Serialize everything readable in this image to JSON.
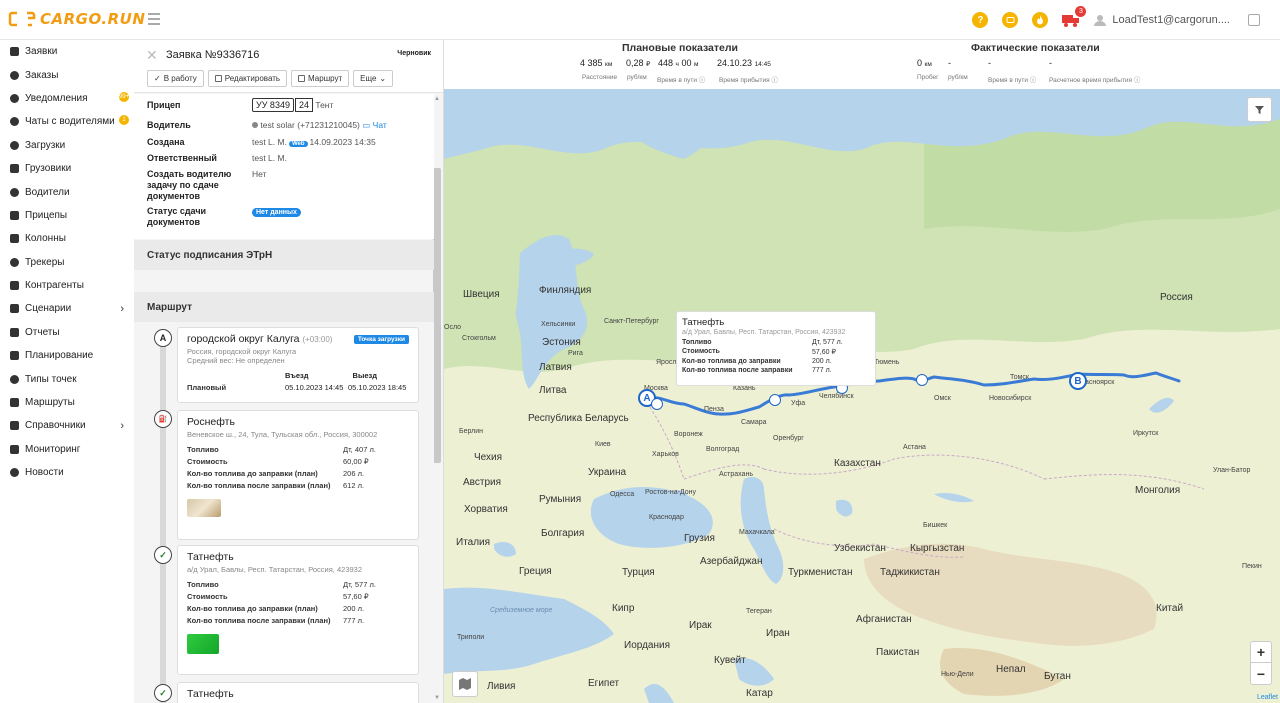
{
  "header": {
    "logo": "CARGO.RUN",
    "help_icon": "?",
    "truck_badge": "3",
    "user": "LoadTest1@cargorun...."
  },
  "sidebar": {
    "items": [
      {
        "label": "Заявки",
        "icon": "clipboard-icon"
      },
      {
        "label": "Заказы",
        "icon": "ruble-icon"
      },
      {
        "label": "Уведомления",
        "icon": "bell-icon",
        "badge": "99+"
      },
      {
        "label": "Чаты с водителями",
        "icon": "chat-icon",
        "badge": "1"
      },
      {
        "label": "Загрузки",
        "icon": "download-icon"
      },
      {
        "label": "Грузовики",
        "icon": "truck-icon"
      },
      {
        "label": "Водители",
        "icon": "steering-wheel-icon"
      },
      {
        "label": "Прицепы",
        "icon": "trailer-icon"
      },
      {
        "label": "Колонны",
        "icon": "convoy-icon"
      },
      {
        "label": "Трекеры",
        "icon": "location-pin-icon"
      },
      {
        "label": "Контрагенты",
        "icon": "handshake-icon"
      },
      {
        "label": "Сценарии",
        "icon": "list-icon",
        "arrow": "›"
      },
      {
        "label": "Отчеты",
        "icon": "report-icon"
      },
      {
        "label": "Планирование",
        "icon": "planning-icon"
      },
      {
        "label": "Типы точек",
        "icon": "pin-icon"
      },
      {
        "label": "Маршруты",
        "icon": "route-icon"
      },
      {
        "label": "Справочники",
        "icon": "book-icon",
        "arrow": "›"
      },
      {
        "label": "Мониторинг",
        "icon": "monitor-icon"
      },
      {
        "label": "Новости",
        "icon": "info-icon"
      }
    ]
  },
  "panel": {
    "title": "Заявка №9336716",
    "status": "Черновик",
    "buttons": {
      "work": "В работу",
      "edit": "Редактировать",
      "route": "Маршрут",
      "more": "Еще"
    },
    "info": {
      "trailer_label": "Прицеп",
      "trailer_plate": "УУ 8349",
      "trailer_region": "24",
      "trailer_name": "Тент",
      "driver_label": "Водитель",
      "driver_value": "test solar",
      "driver_phone": "(+71231210045)",
      "chat": "Чат",
      "created_label": "Создана",
      "created_by": "test L. M.",
      "created_web": "Web",
      "created_date": "14.09.2023 14:35",
      "responsible_label": "Ответственный",
      "responsible_value": "test L. M.",
      "task_label": "Создать водителю задачу по сдаче документов",
      "task_value": "Нет",
      "docs_label": "Статус сдачи документов",
      "docs_value": "Нет данных"
    },
    "etrn_section": "Статус подписания ЭТрН",
    "route_section": "Маршрут",
    "route_pin_a": "A",
    "cards": [
      {
        "title": "городской округ Калуга",
        "tz": "(+03:00)",
        "tag": "Точка загрузки",
        "address": "Россия, городской округ Калуга",
        "weight": "Средний вес: Не определен",
        "entry_label": "Въезд",
        "exit_label": "Выезд",
        "planned_label": "Плановый",
        "entry": "05.10.2023 14:45",
        "exit": "05.10.2023 18:45"
      },
      {
        "title": "Роснефть",
        "address": "Веневское ш., 24, Тула, Тульская обл., Россия, 300002",
        "fuel_label": "Топливо",
        "fuel": "Дт, 407 л.",
        "cost_label": "Стоимость",
        "cost": "60,00 ₽",
        "before_label": "Кол-во топлива до заправки (план)",
        "before": "206 л.",
        "after_label": "Кол-во топлива после заправки (план)",
        "after": "612 л."
      },
      {
        "title": "Татнефть",
        "address": "а/д Урал, Бавлы, Респ. Татарстан, Россия, 423932",
        "fuel_label": "Топливо",
        "fuel": "Дт, 577 л.",
        "cost_label": "Стоимость",
        "cost": "57,60 ₽",
        "before_label": "Кол-во топлива до заправки (план)",
        "before": "200 л.",
        "after_label": "Кол-во топлива после заправки (план)",
        "after": "777 л."
      },
      {
        "title": "Татнефть"
      }
    ]
  },
  "stats": {
    "planned_title": "Плановые показатели",
    "actual_title": "Фактические показатели",
    "planned": {
      "distance": "4 385",
      "distance_unit": "км",
      "rate": "0,28",
      "rate_unit": "₽",
      "time_h": "448",
      "time_m": "00",
      "arrival": "24.10.23",
      "arrival_time": "14:45",
      "l_distance": "Расстояние",
      "l_rate": "руб/км",
      "l_time": "Время в пути",
      "l_arrival": "Время прибытия"
    },
    "actual": {
      "run": "0",
      "run_unit": "км",
      "rate": "-",
      "time": "-",
      "arrival": "-",
      "l_run": "Пробег",
      "l_rate": "руб/км",
      "l_time": "Время в пути",
      "l_arrival": "Расчетное время прибытия"
    }
  },
  "map": {
    "popup": {
      "title": "Татнефть",
      "address": "а/д Урал, Бавлы, Респ. Татарстан, Россия, 423932",
      "fuel_label": "Топливо",
      "fuel": "Дт, 577 л.",
      "cost_label": "Стоимость",
      "cost": "57,60 ₽",
      "before_label": "Кол-во топлива до заправки",
      "before": "200 л.",
      "after_label": "Кол-во топлива после заправки",
      "after": "777 л."
    },
    "pin_a": "A",
    "pin_b": "B",
    "zoom_in": "+",
    "zoom_out": "−",
    "attribution": "Leaflet",
    "labels": {
      "russia": "Россия",
      "sweden": "Швеция",
      "finland": "Финляндия",
      "estonia": "Эстония",
      "latvia": "Латвия",
      "lithuania": "Литва",
      "belarus": "Республика Беларусь",
      "ukraine": "Украина",
      "czech": "Чехия",
      "austria": "Австрия",
      "croatia": "Хорватия",
      "italy": "Италия",
      "romania": "Румыния",
      "bulgaria": "Болгария",
      "greece": "Греция",
      "turkey": "Турция",
      "georgia": "Грузия",
      "azerbaijan": "Азербайджан",
      "kazakhstan": "Казахстан",
      "mongolia": "Монголия",
      "uzbekistan": "Узбекистан",
      "kyrgyzstan": "Кыргызстан",
      "turkmenistan": "Туркменистан",
      "tajikistan": "Таджикистан",
      "afghanistan": "Афганистан",
      "iran": "Иран",
      "iraq": "Ирак",
      "pakistan": "Пакистан",
      "nepal": "Непал",
      "bhutan": "Бутан",
      "china": "Китай",
      "cyprus": "Кипр",
      "jordan": "Иордания",
      "kuwait": "Кувейт",
      "egypt": "Египет",
      "libya": "Ливия",
      "qatar": "Катар",
      "oslo": "Осло",
      "stockholm": "Стокгольм",
      "helsinki": "Хельсинки",
      "spb": "Санкт-Петербург",
      "riga": "Рига",
      "moscow": "Москва",
      "yaroslavl": "Ярославль",
      "kazan": "Казань",
      "samara": "Самара",
      "penza": "Пенза",
      "ufa": "Уфа",
      "chelyabinsk": "Челябинск",
      "tyumen": "Тюмень",
      "omsk": "Омск",
      "novosibirsk": "Новосибирск",
      "tomsk": "Томск",
      "krasnoyarsk": "Красноярск",
      "irkutsk": "Иркутск",
      "orenburg": "Оренбург",
      "astana": "Астана",
      "voronezh": "Воронеж",
      "kharkiv": "Харьков",
      "kyiv": "Киев",
      "odessa": "Одесса",
      "rostov": "Ростов-на-Дону",
      "volgograd": "Волгоград",
      "astrakhan": "Астрахань",
      "krasnodar": "Краснодар",
      "makhachkala": "Махачкала",
      "bishkek": "Бишкек",
      "berlin": "Берлин",
      "ulaanbaatar": "Улан-Батор",
      "beijing": "Пекин",
      "delhi": "Нью-Дели",
      "tehran": "Тегеран",
      "tripoli": "Триполи",
      "medsea": "Средиземное море"
    }
  }
}
